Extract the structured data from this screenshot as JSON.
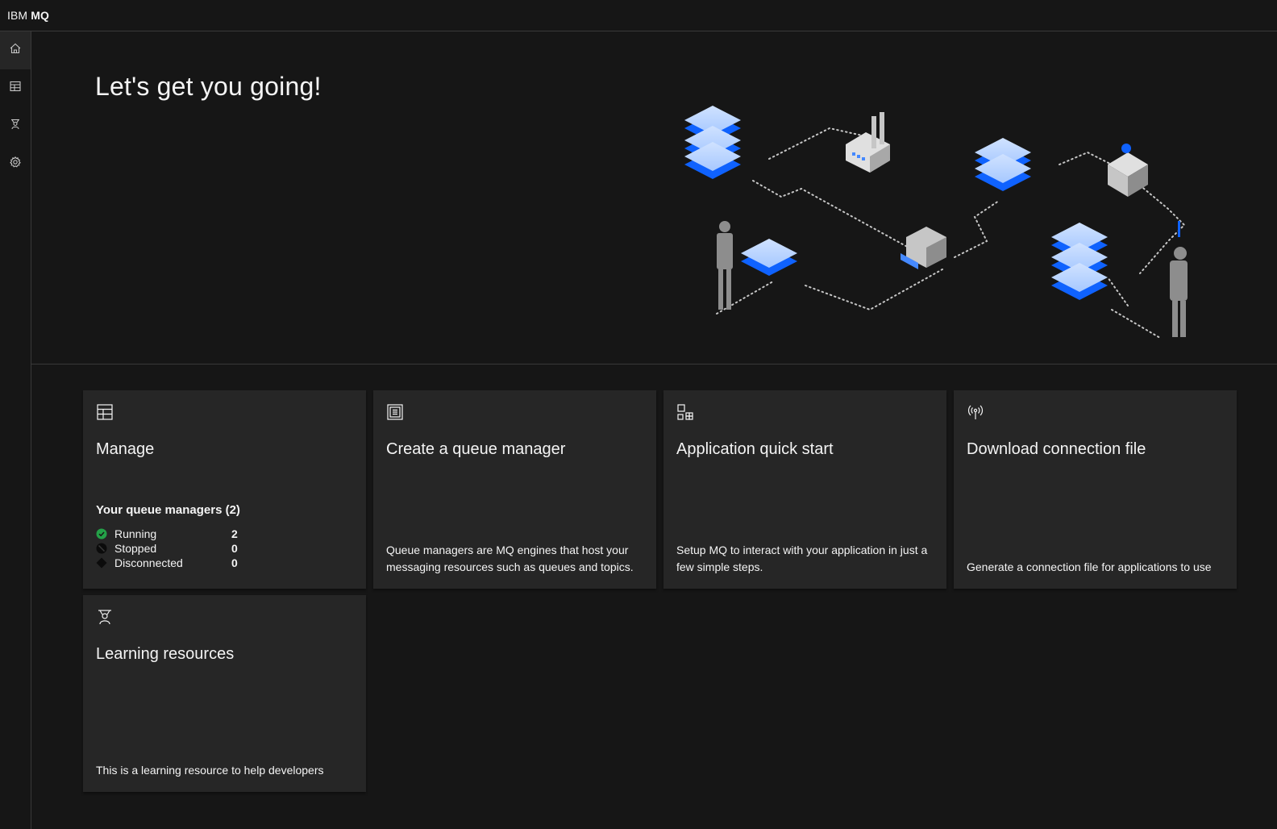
{
  "header": {
    "brand": "IBM",
    "product": "MQ"
  },
  "sidenav": {
    "items": [
      {
        "name": "home",
        "icon": "home-icon",
        "active": true
      },
      {
        "name": "manage",
        "icon": "table-icon",
        "active": false
      },
      {
        "name": "learning",
        "icon": "learning-icon",
        "active": false
      },
      {
        "name": "settings",
        "icon": "gear-icon",
        "active": false
      }
    ]
  },
  "hero": {
    "title": "Let's get you going!"
  },
  "tiles": {
    "manage": {
      "icon": "table-icon",
      "title": "Manage",
      "summary_heading": "Your queue managers (2)",
      "statuses": [
        {
          "label": "Running",
          "count": "2",
          "color": "#24a148"
        },
        {
          "label": "Stopped",
          "count": "0",
          "color": "#161616"
        },
        {
          "label": "Disconnected",
          "count": "0",
          "color": "#161616"
        }
      ]
    },
    "create": {
      "icon": "document-icon",
      "title": "Create a queue manager",
      "description": "Queue managers are MQ engines that host your messaging resources such as queues and topics."
    },
    "quickstart": {
      "icon": "apps-icon",
      "title": "Application quick start",
      "description": "Setup MQ to interact with your application in just a few simple steps."
    },
    "download": {
      "icon": "antenna-icon",
      "title": "Download connection file",
      "description": "Generate a connection file for applications to use"
    },
    "learning": {
      "icon": "learning-icon",
      "title": "Learning resources",
      "description": "This is a learning resource to help developers"
    }
  },
  "colors": {
    "background": "#161616",
    "tile": "#262626",
    "accent": "#0f62fe",
    "running": "#24a148"
  }
}
